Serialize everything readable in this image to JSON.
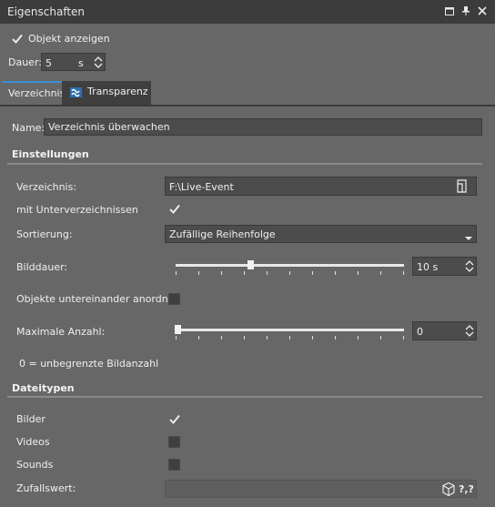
{
  "window": {
    "title": "Eigenschaften"
  },
  "top": {
    "show_object_label": "Objekt anzeigen",
    "show_object_checked": true,
    "duration_label": "Dauer:",
    "duration_value": "5",
    "duration_unit": "s"
  },
  "tabs": [
    {
      "label": "Verzeichnis",
      "active": true
    },
    {
      "label": "Transparenz",
      "active": false,
      "icon": "transparency-icon"
    }
  ],
  "name": {
    "label": "Name:",
    "value": "Verzeichnis überwachen"
  },
  "settings": {
    "header": "Einstellungen",
    "directory_label": "Verzeichnis:",
    "directory_value": "F:\\Live-Event",
    "subdirs_label": "mit Unterverzeichnissen",
    "subdirs_checked": true,
    "sort_label": "Sortierung:",
    "sort_value": "Zufällige Reihenfolge",
    "image_duration_label": "Bilddauer:",
    "image_duration_value": "10 s",
    "image_duration_level": 0.4,
    "arrange_label": "Objekte untereinander anordnen",
    "arrange_checked": false,
    "max_count_label": "Maximale Anzahl:",
    "max_count_value": "0",
    "max_count_level": 0.0,
    "hint": "0 = unbegrenzte Bildanzahl"
  },
  "filetypes": {
    "header": "Dateitypen",
    "images_label": "Bilder",
    "images_checked": true,
    "videos_label": "Videos",
    "videos_checked": false,
    "sounds_label": "Sounds",
    "sounds_checked": false,
    "random_label": "Zufallswert:",
    "random_value": ""
  },
  "colors": {
    "accent": "#3b8fd6",
    "panel": "#676767",
    "titlebar": "#3c3c3c"
  }
}
